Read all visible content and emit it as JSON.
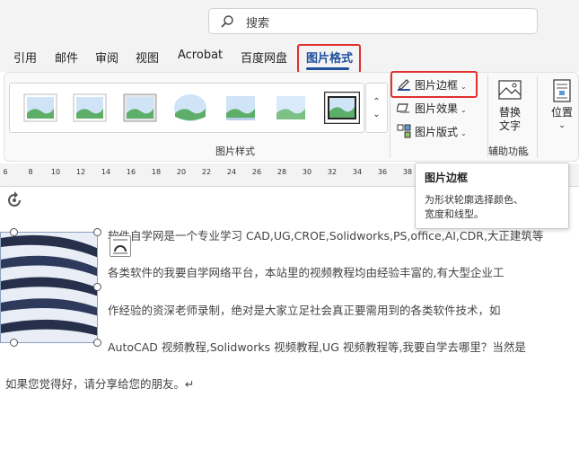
{
  "search": {
    "placeholder": "搜索",
    "icon": "search-icon"
  },
  "tabs": [
    {
      "label": "引用"
    },
    {
      "label": "邮件"
    },
    {
      "label": "审阅"
    },
    {
      "label": "视图"
    },
    {
      "label": "Acrobat"
    },
    {
      "label": "百度网盘"
    },
    {
      "label": "图片格式",
      "active": true
    }
  ],
  "ribbon": {
    "gallery_group_label": "图片样式",
    "picture_border": {
      "label": "图片边框",
      "icon": "pen-border-icon"
    },
    "picture_effects": {
      "label": "图片效果",
      "icon": "effects-icon"
    },
    "picture_layout": {
      "label": "图片版式",
      "icon": "layout-icon"
    },
    "alt_text": {
      "line1": "替换",
      "line2": "文字",
      "icon": "alt-text-icon"
    },
    "accessibility_label": "辅助功能",
    "position": {
      "label": "位置",
      "icon": "position-icon"
    }
  },
  "ruler": {
    "ticks": [
      "6",
      "8",
      "10",
      "12",
      "14",
      "16",
      "18",
      "20",
      "22",
      "24",
      "26",
      "28",
      "30",
      "32",
      "34",
      "36",
      "38"
    ]
  },
  "tooltip": {
    "title": "图片边框",
    "body_line1": "为形状轮廓选择颜色、",
    "body_line2": "宽度和线型。"
  },
  "document": {
    "line1": "软件自学网是一个专业学习 CAD,UG,CROE,Solidworks,PS,office,AI,CDR,大正建筑等",
    "line2": "各类软件的我要自学网络平台，本站里的视频教程均由经验丰富的,有大型企业工",
    "line3": "作经验的资深老师录制，绝对是大家立足社会真正要需用到的各类软件技术，如",
    "line4": "AutoCAD 视频教程,Solidworks 视频教程,UG 视频教程等,我要自学去哪里？当然是",
    "line5": "如果您觉得好，请分享给您的朋友。↵"
  },
  "colors": {
    "accent": "#1f4e9c",
    "highlight_box": "#e03030"
  }
}
